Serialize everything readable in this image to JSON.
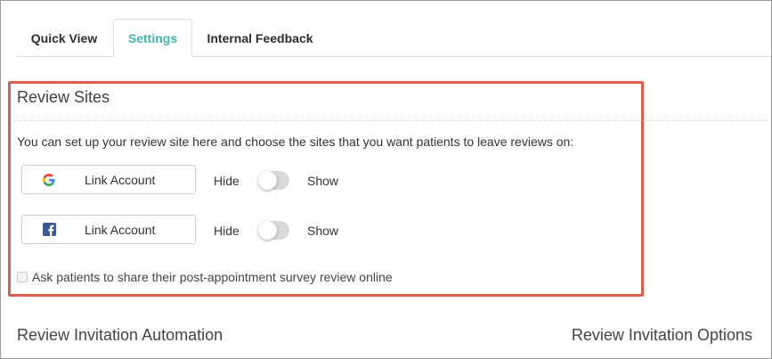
{
  "tabs": [
    {
      "label": "Quick View"
    },
    {
      "label": "Settings"
    },
    {
      "label": "Internal Feedback"
    }
  ],
  "review_sites": {
    "title": "Review Sites",
    "intro": "You can set up your review site here and choose the sites that you want patients to leave reviews on:",
    "sites": [
      {
        "icon": "google-icon",
        "button_label": "Link Account",
        "hide_label": "Hide",
        "show_label": "Show",
        "enabled": false
      },
      {
        "icon": "facebook-icon",
        "button_label": "Link Account",
        "hide_label": "Hide",
        "show_label": "Show",
        "enabled": false
      }
    ],
    "share_checkbox_label": "Ask patients to share their post-appointment survey review online",
    "share_checked": false
  },
  "sections": {
    "automation_title": "Review Invitation Automation",
    "options_title": "Review Invitation Options"
  },
  "colors": {
    "active_tab": "#3fb5b5",
    "highlight_border": "#d9604a",
    "facebook_blue": "#3b5998"
  }
}
